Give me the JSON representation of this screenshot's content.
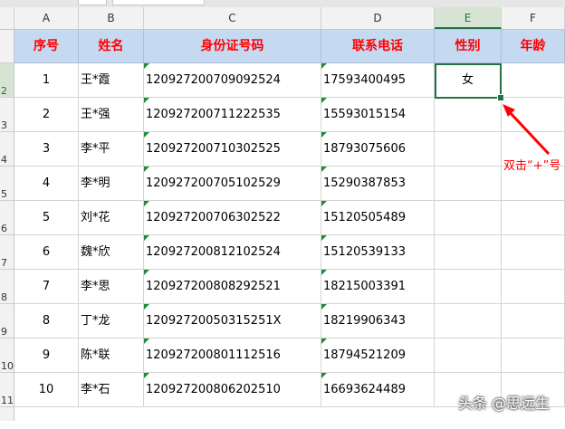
{
  "columns": [
    "A",
    "B",
    "C",
    "D",
    "E",
    "F"
  ],
  "row_numbers": [
    "2",
    "3",
    "4",
    "5",
    "6",
    "7",
    "8",
    "9",
    "10",
    "11"
  ],
  "headers": [
    "序号",
    "姓名",
    "身份证号码",
    "联系电话",
    "性别",
    "年龄"
  ],
  "rows": [
    {
      "no": "1",
      "name": "王*霞",
      "id": "120927200709092524",
      "phone": "17593400495",
      "gender": "女",
      "age": ""
    },
    {
      "no": "2",
      "name": "王*强",
      "id": "120927200711222535",
      "phone": "15593015154",
      "gender": "",
      "age": ""
    },
    {
      "no": "3",
      "name": "李*平",
      "id": "120927200710302525",
      "phone": "18793075606",
      "gender": "",
      "age": ""
    },
    {
      "no": "4",
      "name": "李*明",
      "id": "120927200705102529",
      "phone": "15290387853",
      "gender": "",
      "age": ""
    },
    {
      "no": "5",
      "name": "刘*花",
      "id": "120927200706302522",
      "phone": "15120505489",
      "gender": "",
      "age": ""
    },
    {
      "no": "6",
      "name": "魏*欣",
      "id": "120927200812102524",
      "phone": "15120539133",
      "gender": "",
      "age": ""
    },
    {
      "no": "7",
      "name": "李*思",
      "id": "120927200808292521",
      "phone": "18215003391",
      "gender": "",
      "age": ""
    },
    {
      "no": "8",
      "name": "丁*龙",
      "id": "12092720050315251X",
      "phone": "18219906343",
      "gender": "",
      "age": ""
    },
    {
      "no": "9",
      "name": "陈*联",
      "id": "120927200801112516",
      "phone": "18794521209",
      "gender": "",
      "age": ""
    },
    {
      "no": "10",
      "name": "李*石",
      "id": "120927200806202510",
      "phone": "16693624489",
      "gender": "",
      "age": ""
    }
  ],
  "annotation": "双击“+”号",
  "watermark": "头条 @思远生",
  "colors": {
    "header_fill": "#c5d9f1",
    "header_text": "#ff0000",
    "selection": "#217346",
    "annotation": "#ff0000"
  },
  "icons": [
    "arrow-icon",
    "fill-handle-icon",
    "text-number-indicator-icon"
  ]
}
